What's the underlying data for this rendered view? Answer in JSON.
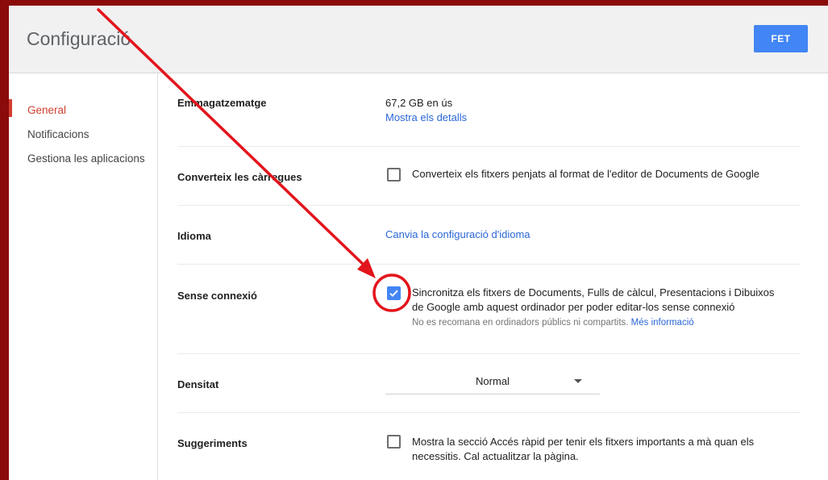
{
  "header": {
    "title": "Configuració",
    "done_label": "FET"
  },
  "sidebar": {
    "items": [
      {
        "label": "General",
        "active": true
      },
      {
        "label": "Notificacions",
        "active": false
      },
      {
        "label": "Gestiona les aplicacions",
        "active": false
      }
    ]
  },
  "settings": {
    "storage": {
      "label": "Emmagatzematge",
      "usage": "67,2 GB en ús",
      "details_link": "Mostra els detalls"
    },
    "convert": {
      "label": "Converteix les càrregues",
      "checked": false,
      "text": "Converteix els fitxers penjats al format de l'editor de Documents de Google"
    },
    "language": {
      "label": "Idioma",
      "link": "Canvia la configuració d'idioma"
    },
    "offline": {
      "label": "Sense connexió",
      "checked": true,
      "text_line1": "Sincronitza els fitxers de Documents, Fulls de càlcul, Presentacions i Dibuixos",
      "text_line2": "de Google amb aquest ordinador per poder editar-los sense connexió",
      "note": "No es recomana en ordinadors públics ni compartits.",
      "more_link": "Més informació"
    },
    "density": {
      "label": "Densitat",
      "value": "Normal"
    },
    "suggestions": {
      "label": "Suggeriments",
      "checked": false,
      "text_line1": "Mostra la secció Accés ràpid per tenir els fitxers importants a mà quan els",
      "text_line2": "necessitis. Cal actualitzar la pàgina."
    }
  },
  "colors": {
    "accent": "#4285f4",
    "active_nav": "#d23f31",
    "annotation": "#e3141c",
    "frame": "#8b0a0a"
  },
  "icons": {
    "check": "check-icon",
    "dropdown": "chevron-down-icon"
  }
}
